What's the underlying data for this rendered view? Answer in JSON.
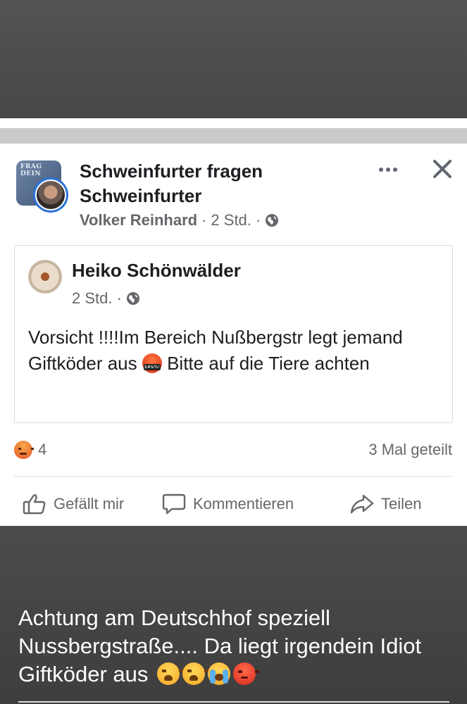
{
  "post": {
    "group_name": "Schweinfurter fragen Schweinfurter",
    "group_avatar_text": "FRAG DEIN",
    "author": "Volker Reinhard",
    "separator": "·",
    "time": "2 Std.",
    "privacy_icon": "globe-icon",
    "shared": {
      "author": "Heiko Schönwälder",
      "time": "2 Std.",
      "text_part1": "Vorsicht !!!!Im Bereich Nußbergstr legt jemand Giftköder aus ",
      "text_emoji": "face-with-symbols-on-mouth",
      "text_part2": " Bitte auf die Tiere achten"
    },
    "reactions": {
      "icon": "angry-reaction-icon",
      "count": "4",
      "shares": "3 Mal geteilt"
    },
    "actions": {
      "like": "Gefällt mir",
      "comment": "Kommentieren",
      "share": "Teilen"
    }
  },
  "caption": {
    "text": "Achtung am Deutschhof speziell Nussbergstraße.... Da liegt irgendein Idiot Giftköder aus ",
    "emojis": [
      "weary-face",
      "weary-face",
      "loudly-crying-face",
      "angry-face"
    ]
  },
  "colors": {
    "text_primary": "#1c1e21",
    "text_secondary": "#65676b",
    "divider": "#dadde1",
    "overlay_bg": "#4a4a4a"
  }
}
